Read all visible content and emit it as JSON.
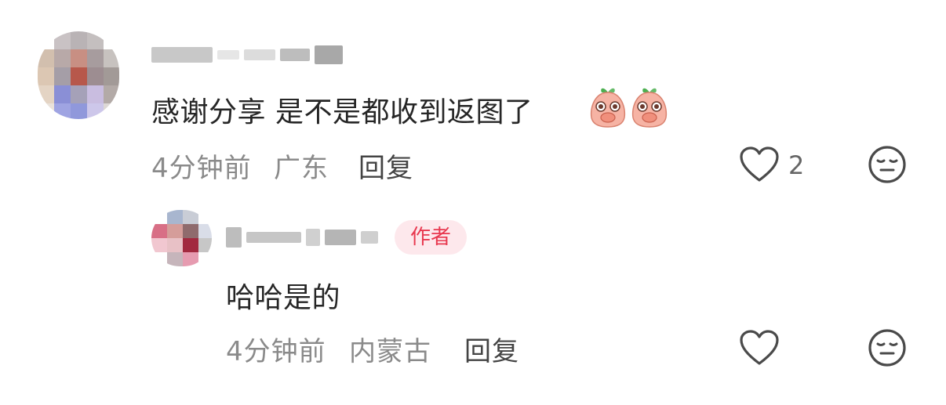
{
  "comment": {
    "text": "感谢分享 是不是都收到返图了",
    "emojis": [
      "peach-cover-mouth-emoji",
      "peach-cover-mouth-emoji"
    ],
    "time": "4分钟前",
    "location": "广东",
    "reply_label": "回复",
    "like_count": "2"
  },
  "reply": {
    "author_tag": "作者",
    "text": "哈哈是的",
    "time": "4分钟前",
    "location": "内蒙古",
    "reply_label": "回复"
  },
  "icons": {
    "like": "heart-outline-icon",
    "dislike": "meh-face-icon"
  },
  "colors": {
    "author_tag_bg": "#fde8ec",
    "author_tag_text": "#e8384f",
    "meta_text": "#8a8a8a",
    "body_text": "#262626"
  }
}
